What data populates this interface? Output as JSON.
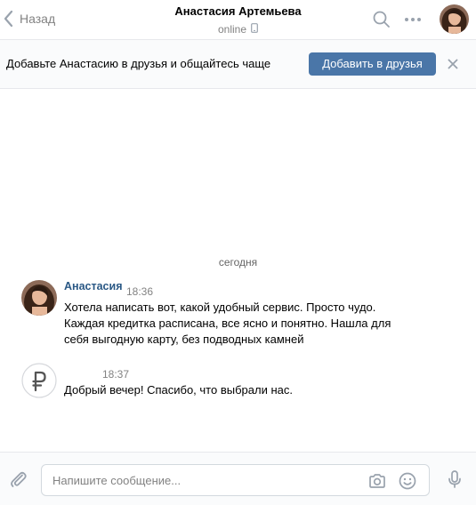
{
  "header": {
    "back_label": "Назад",
    "title": "Анастасия Артемьева",
    "status": "online"
  },
  "friend_bar": {
    "text": "Добавьте Анастасию в друзья и общайтесь чаще",
    "button_label": "Добавить в друзья"
  },
  "chat": {
    "date_separator": "сегодня",
    "messages": [
      {
        "author": "Анастасия",
        "time": "18:36",
        "lines": [
          "Хотела написать вот, какой удобный сервис. Просто чудо.",
          "Каждая кредитка расписана, все ясно и понятно. Нашла для",
          "себя выгодную карту, без подводных камней"
        ]
      },
      {
        "time": "18:37",
        "lines": [
          "Добрый вечер! Спасибо, что выбрали нас."
        ]
      }
    ]
  },
  "composer": {
    "placeholder": "Напишите сообщение..."
  },
  "colors": {
    "accent": "#4a76a8",
    "author_link": "#2a5885",
    "muted_text": "#828282",
    "icon_gray": "#99a2ad",
    "divider": "#e7e8ec"
  },
  "icons": {
    "back": "chevron-left-icon",
    "phone": "mobile-phone-icon",
    "search": "search-icon",
    "more": "more-dots-icon",
    "close": "close-icon",
    "attach": "paperclip-icon",
    "camera": "camera-icon",
    "emoji": "smile-icon",
    "mic": "microphone-icon",
    "service_logo": "ruble-logo-icon"
  }
}
